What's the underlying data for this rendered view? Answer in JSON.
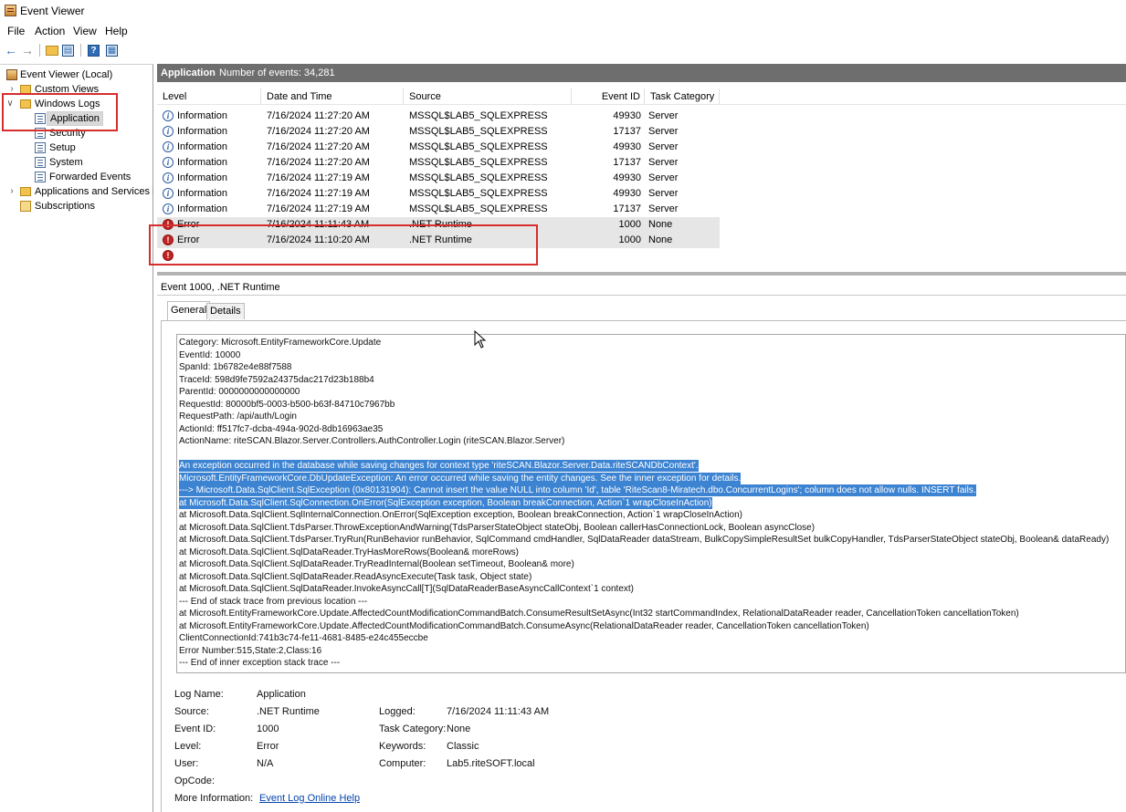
{
  "window": {
    "title": "Event Viewer"
  },
  "menu": [
    "File",
    "Action",
    "View",
    "Help"
  ],
  "toolbar": {
    "back_icon": "back-arrow-icon",
    "forward_icon": "forward-arrow-icon",
    "open_icon": "folder-open-icon",
    "properties_icon": "properties-icon",
    "help_icon": "help-icon",
    "console_icon": "console-icon"
  },
  "tree": {
    "root": "Event Viewer (Local)",
    "custom_views": "Custom Views",
    "windows_logs": "Windows Logs",
    "application": "Application",
    "security": "Security",
    "setup": "Setup",
    "system": "System",
    "forwarded": "Forwarded Events",
    "apps_services": "Applications and Services Lo",
    "subscriptions": "Subscriptions"
  },
  "list_header": {
    "name": "Application",
    "count": "Number of events: 34,281"
  },
  "columns": [
    "Level",
    "Date and Time",
    "Source",
    "Event ID",
    "Task Category"
  ],
  "events": [
    {
      "level": "Information",
      "date": "7/16/2024 11:27:20 AM",
      "source": "MSSQL$LAB5_SQLEXPRESS",
      "id": "49930",
      "category": "Server"
    },
    {
      "level": "Information",
      "date": "7/16/2024 11:27:20 AM",
      "source": "MSSQL$LAB5_SQLEXPRESS",
      "id": "17137",
      "category": "Server"
    },
    {
      "level": "Information",
      "date": "7/16/2024 11:27:20 AM",
      "source": "MSSQL$LAB5_SQLEXPRESS",
      "id": "49930",
      "category": "Server"
    },
    {
      "level": "Information",
      "date": "7/16/2024 11:27:20 AM",
      "source": "MSSQL$LAB5_SQLEXPRESS",
      "id": "17137",
      "category": "Server"
    },
    {
      "level": "Information",
      "date": "7/16/2024 11:27:19 AM",
      "source": "MSSQL$LAB5_SQLEXPRESS",
      "id": "49930",
      "category": "Server"
    },
    {
      "level": "Information",
      "date": "7/16/2024 11:27:19 AM",
      "source": "MSSQL$LAB5_SQLEXPRESS",
      "id": "49930",
      "category": "Server"
    },
    {
      "level": "Information",
      "date": "7/16/2024 11:27:19 AM",
      "source": "MSSQL$LAB5_SQLEXPRESS",
      "id": "17137",
      "category": "Server"
    },
    {
      "level": "Error",
      "date": "7/16/2024 11:11:43 AM",
      "source": ".NET Runtime",
      "id": "1000",
      "category": "None"
    },
    {
      "level": "Error",
      "date": "7/16/2024 11:10:20 AM",
      "source": ".NET Runtime",
      "id": "1000",
      "category": "None"
    }
  ],
  "detail": {
    "title": "Event 1000, .NET Runtime",
    "tabs": [
      "General",
      "Details"
    ],
    "message_lines": [
      "Category: Microsoft.EntityFrameworkCore.Update",
      "EventId: 10000",
      "SpanId: 1b6782e4e88f7588",
      "TraceId: 598d9fe7592a24375dac217d23b188b4",
      "ParentId: 0000000000000000",
      "RequestId: 80000bf5-0003-b500-b63f-84710c7967bb",
      "RequestPath: /api/auth/Login",
      "ActionId: ff517fc7-dcba-494a-902d-8db16963ae35",
      "ActionName: riteSCAN.Blazor.Server.Controllers.AuthController.Login (riteSCAN.Blazor.Server)",
      "",
      "An exception occurred in the database while saving changes for context type 'riteSCAN.Blazor.Server.Data.riteSCANDbContext'.",
      "Microsoft.EntityFrameworkCore.DbUpdateException: An error occurred while saving the entity changes. See the inner exception for details.",
      " ---> Microsoft.Data.SqlClient.SqlException (0x80131904): Cannot insert the value NULL into column 'Id', table 'RiteScan8-Miratech.dbo.ConcurrentLogins'; column does not allow nulls. INSERT fails.",
      "   at Microsoft.Data.SqlClient.SqlConnection.OnError(SqlException exception, Boolean breakConnection, Action`1 wrapCloseInAction)",
      "   at Microsoft.Data.SqlClient.SqlInternalConnection.OnError(SqlException exception, Boolean breakConnection, Action`1 wrapCloseInAction)",
      "   at Microsoft.Data.SqlClient.TdsParser.ThrowExceptionAndWarning(TdsParserStateObject stateObj, Boolean callerHasConnectionLock, Boolean asyncClose)",
      "   at Microsoft.Data.SqlClient.TdsParser.TryRun(RunBehavior runBehavior, SqlCommand cmdHandler, SqlDataReader dataStream, BulkCopySimpleResultSet bulkCopyHandler, TdsParserStateObject stateObj, Boolean& dataReady)",
      "   at Microsoft.Data.SqlClient.SqlDataReader.TryHasMoreRows(Boolean& moreRows)",
      "   at Microsoft.Data.SqlClient.SqlDataReader.TryReadInternal(Boolean setTimeout, Boolean& more)",
      "   at Microsoft.Data.SqlClient.SqlDataReader.ReadAsyncExecute(Task task, Object state)",
      "   at Microsoft.Data.SqlClient.SqlDataReader.InvokeAsyncCall[T](SqlDataReaderBaseAsyncCallContext`1 context)",
      "--- End of stack trace from previous location ---",
      "   at Microsoft.EntityFrameworkCore.Update.AffectedCountModificationCommandBatch.ConsumeResultSetAsync(Int32 startCommandIndex, RelationalDataReader reader, CancellationToken cancellationToken)",
      "   at Microsoft.EntityFrameworkCore.Update.AffectedCountModificationCommandBatch.ConsumeAsync(RelationalDataReader reader, CancellationToken cancellationToken)",
      "ClientConnectionId:741b3c74-fe11-4681-8485-e24c455eccbe",
      "Error Number:515,State:2,Class:16",
      "   --- End of inner exception stack trace ---"
    ],
    "props": {
      "log_name_label": "Log Name:",
      "log_name": "Application",
      "source_label": "Source:",
      "source": ".NET Runtime",
      "logged_label": "Logged:",
      "logged": "7/16/2024 11:11:43 AM",
      "event_id_label": "Event ID:",
      "event_id": "1000",
      "task_category_label": "Task Category:",
      "task_category": "None",
      "level_label": "Level:",
      "level": "Error",
      "keywords_label": "Keywords:",
      "keywords": "Classic",
      "user_label": "User:",
      "user": "N/A",
      "computer_label": "Computer:",
      "computer": "Lab5.riteSOFT.local",
      "opcode_label": "OpCode:",
      "more_info_label": "More Information:",
      "more_info_link": "Event Log Online Help"
    }
  },
  "colors": {
    "selection": "#3c83d2",
    "annotation": "#d62d2d",
    "list_header": "#6e6e6e"
  }
}
